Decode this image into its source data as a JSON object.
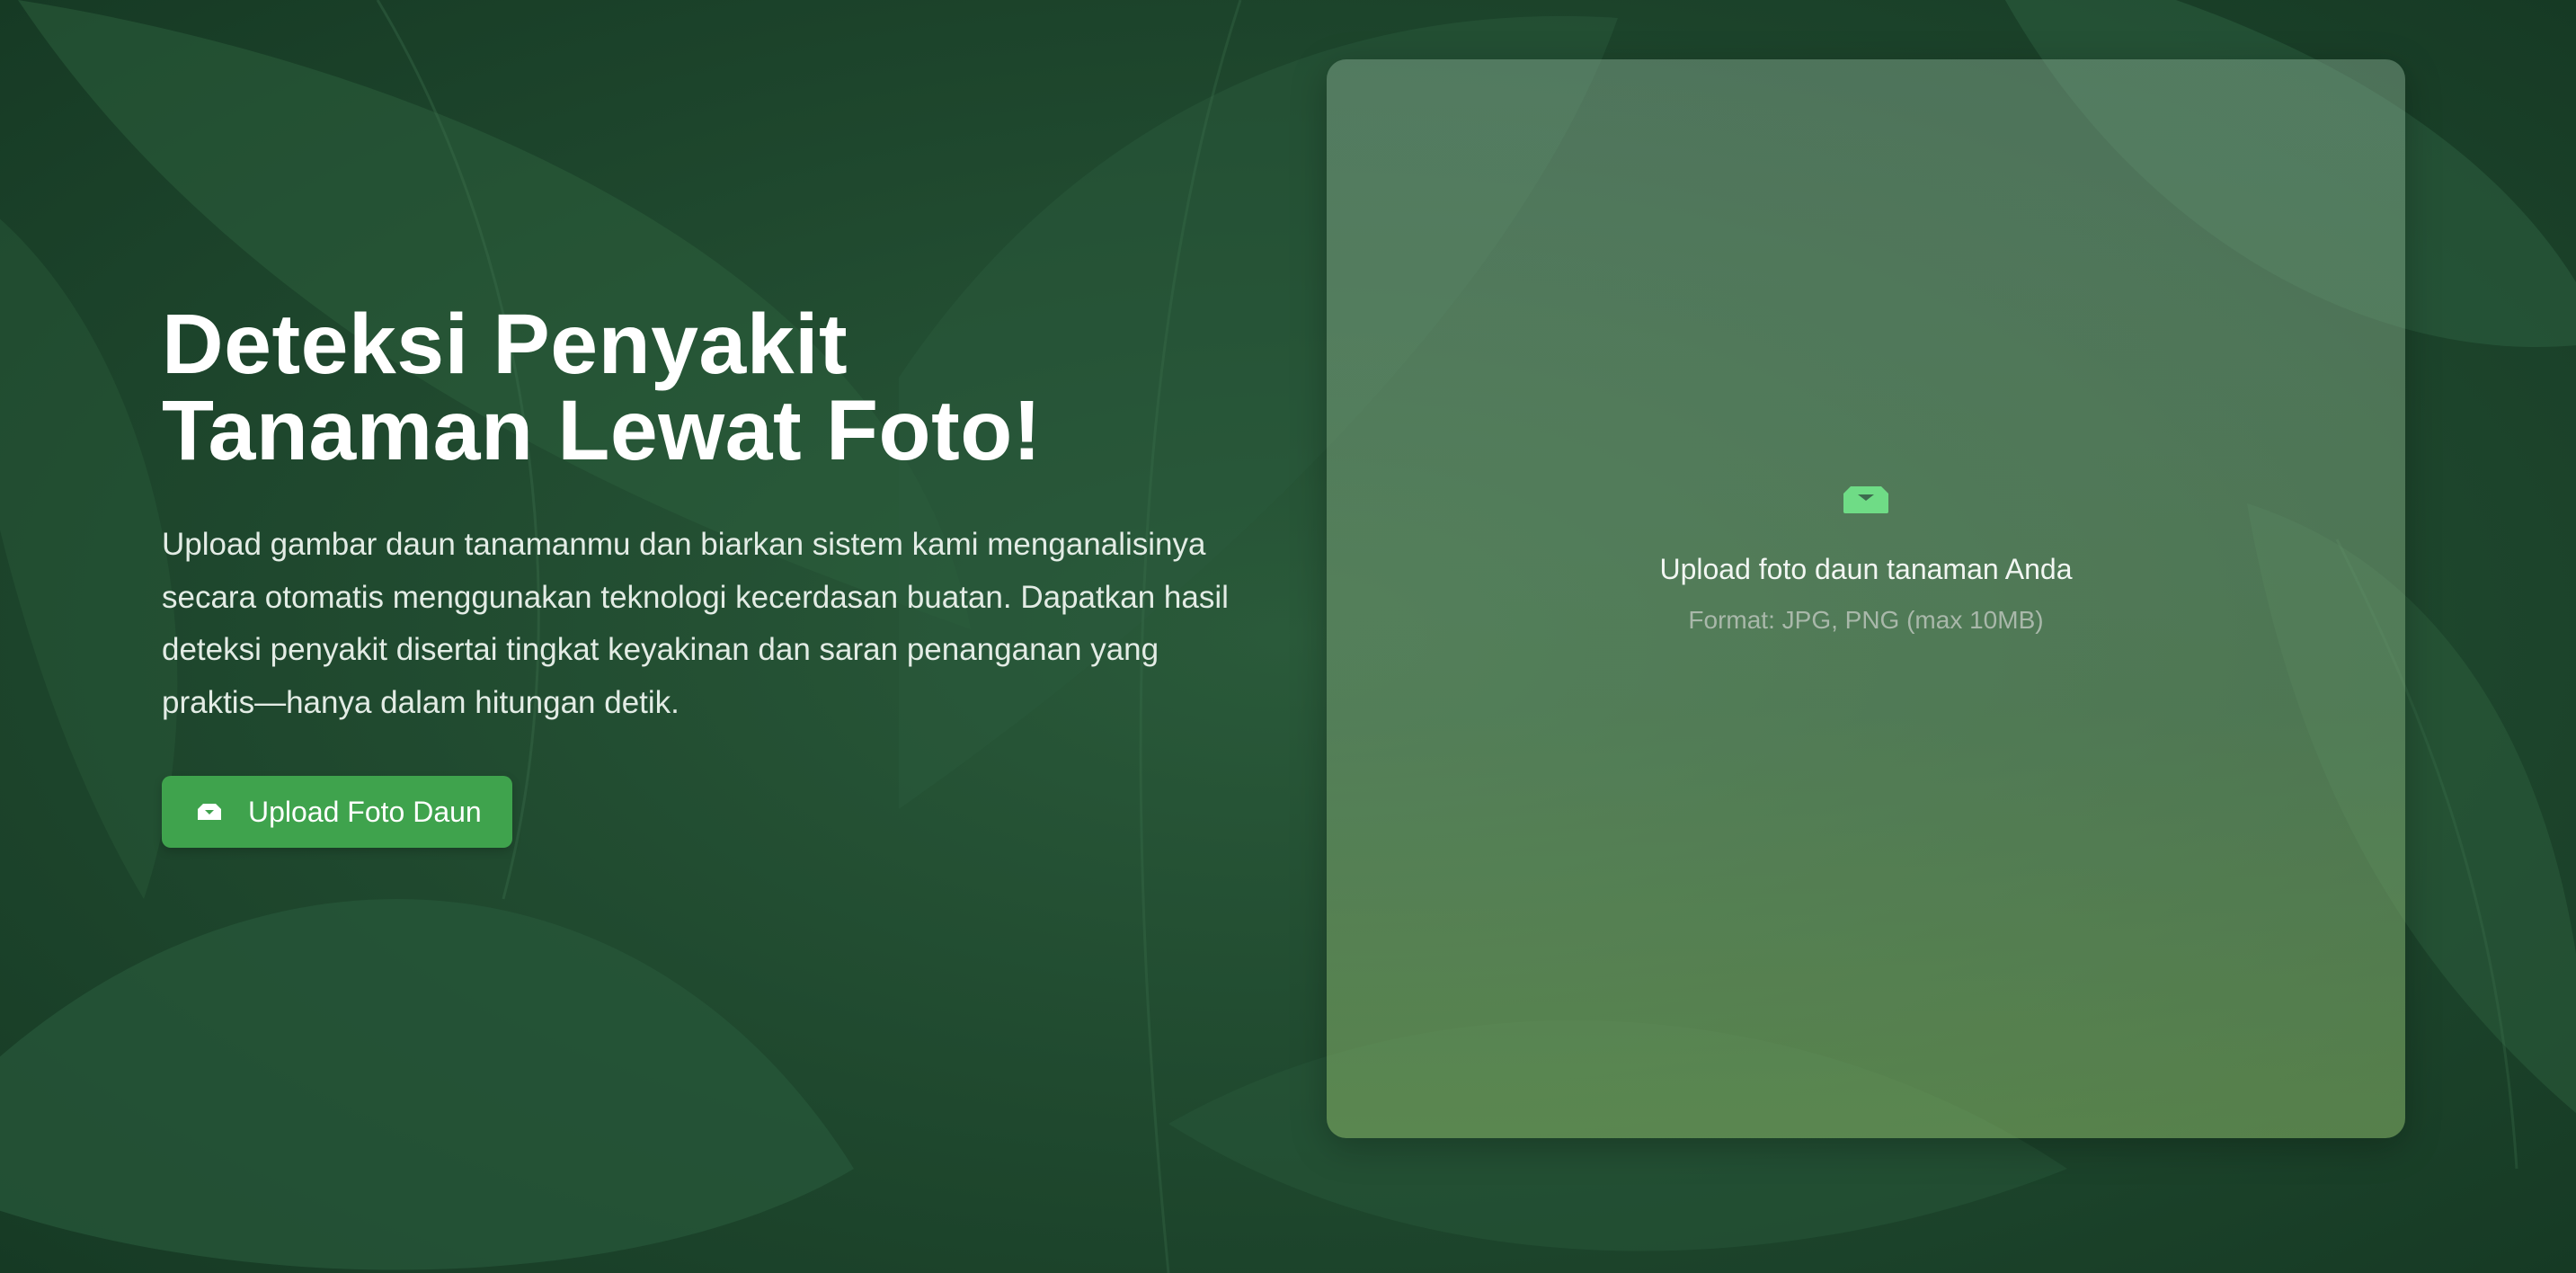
{
  "hero": {
    "title_line1": "Deteksi Penyakit",
    "title_line2": "Tanaman Lewat Foto!",
    "description": "Upload gambar daun tanamanmu dan biarkan sistem kami menganalisinya secara otomatis menggunakan teknologi kecerdasan buatan. Dapatkan hasil deteksi penyakit disertai tingkat keyakinan dan saran penanganan yang praktis—hanya dalam hitungan detik.",
    "upload_button_label": "Upload Foto Daun",
    "upload_button_icon": "inbox-tray-icon"
  },
  "dropzone": {
    "icon": "inbox-tray-icon",
    "title": "Upload foto daun tanaman Anda",
    "format_hint": "Format: JPG, PNG (max 10MB)"
  },
  "colors": {
    "background": "#1e4a30",
    "accent_button": "#3fa34d",
    "dropzone_icon": "#6fdc86"
  }
}
